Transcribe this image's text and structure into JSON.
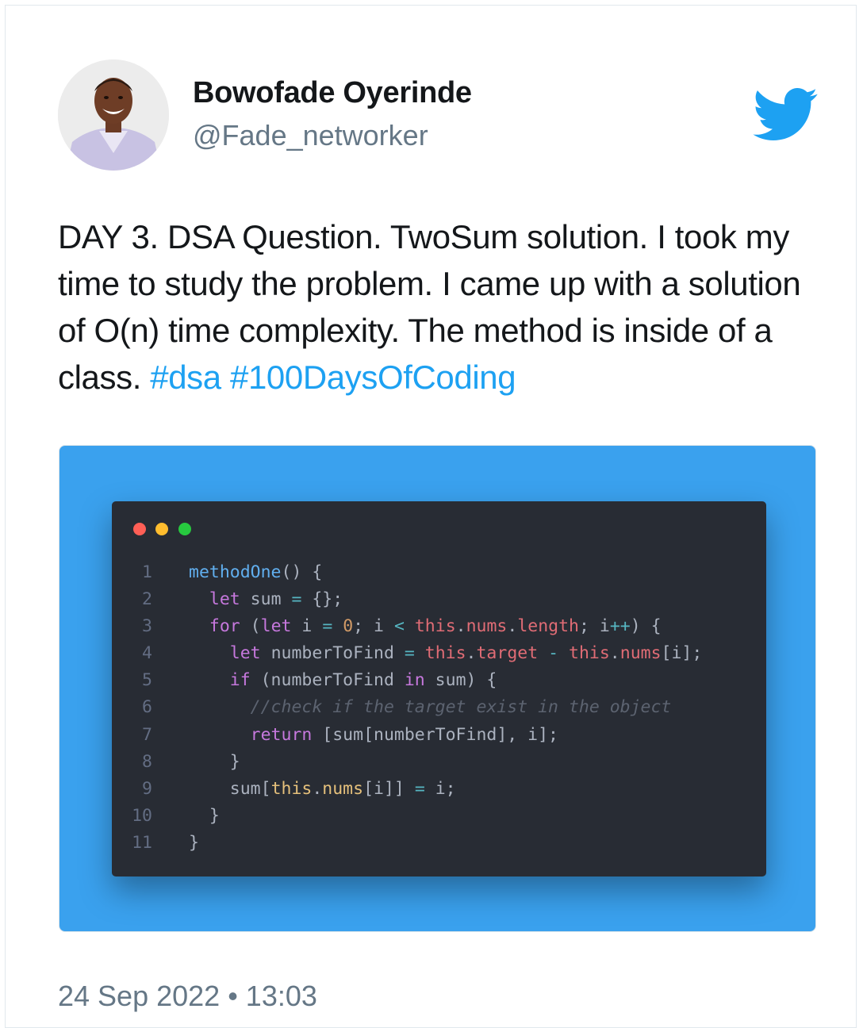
{
  "user": {
    "display_name": "Bowofade Oyerinde",
    "handle": "@Fade_networker",
    "avatar_icon": "profile-photo"
  },
  "tweet": {
    "text": "DAY 3. DSA Question. TwoSum solution. I took my time to study the problem. I came up with a solution of O(n) time complexity. The method is inside of a class.",
    "hashtags": [
      "#dsa",
      "#100DaysOfCoding"
    ],
    "timestamp": "24 Sep 2022 • 13:03"
  },
  "brand": {
    "icon": "twitter-bird-icon",
    "color": "#1da1f2"
  },
  "media": {
    "background_color": "#3aa1ee",
    "window_dots": [
      "#ff5f56",
      "#ffbd2e",
      "#27c93f"
    ],
    "line_numbers": [
      "1",
      "2",
      "3",
      "4",
      "5",
      "6",
      "7",
      "8",
      "9",
      "10",
      "11"
    ],
    "code_lines": [
      "methodOne() {",
      "  let sum = {};",
      "  for (let i = 0; i < this.nums.length; i++) {",
      "    let numberToFind = this.target - this.nums[i];",
      "    if (numberToFind in sum) {",
      "      //check if the target exist in the object",
      "      return [sum[numberToFind], i];",
      "    }",
      "    sum[this.nums[i]] = i;",
      "  }",
      "}"
    ]
  }
}
